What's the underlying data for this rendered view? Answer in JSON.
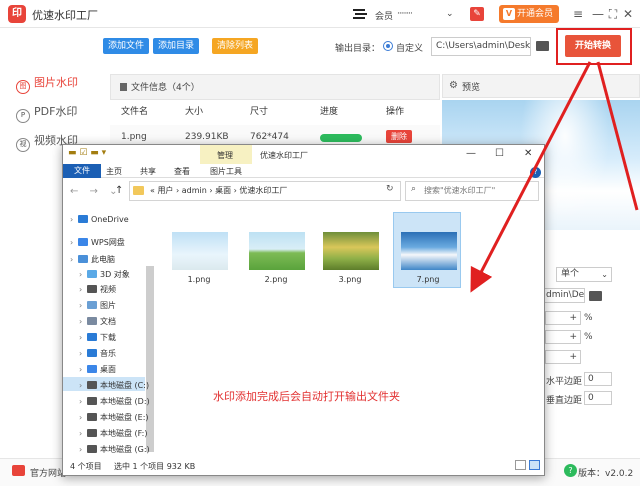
{
  "app": {
    "title": "优速水印工厂",
    "logo_text": "印",
    "member_label": "会员",
    "member_mask": "········",
    "vip_button": "开通会员",
    "vip_icon_text": "V",
    "win_minimize": "—",
    "win_maximize": "⛶",
    "win_close": "✕",
    "win_menu": "≡"
  },
  "sidebar": {
    "items": [
      {
        "label": "图片水印",
        "icon": "图"
      },
      {
        "label": "PDF水印",
        "icon": "P"
      },
      {
        "label": "视频水印",
        "icon": "视"
      }
    ]
  },
  "toolbar": {
    "add_file": "添加文件",
    "add_dir": "添加目录",
    "clear_list": "清除列表",
    "output_label": "输出目录：",
    "custom_label": "自定义",
    "output_path": "C:\\Users\\admin\\Deskto",
    "start_button": "开始转换"
  },
  "file_info": {
    "title": "文件信息（4个）",
    "columns": [
      "文件名",
      "大小",
      "尺寸",
      "进度",
      "操作"
    ],
    "row": {
      "name": "1.png",
      "size": "239.91KB",
      "dims": "762*474",
      "delete": "删除"
    }
  },
  "preview": {
    "title": "预览"
  },
  "options": {
    "select_value": "单个",
    "path_value": "dmin\\Des",
    "pct": "%",
    "h_margin": "水平边距",
    "v_margin": "垂直边距",
    "h_value": "0",
    "v_value": "0"
  },
  "footer": {
    "site": "官方网站",
    "help": "?",
    "version": "版本：v2.0.2"
  },
  "explorer": {
    "name": "优速水印工厂",
    "manage_tab": "管理",
    "picture_tools": "图片工具",
    "tabs": [
      "文件",
      "主页",
      "共享",
      "查看"
    ],
    "address": "«  用户  ›  admin  ›  桌面  ›  优速水印工厂",
    "search_placeholder": "搜索\"优速水印工厂\"",
    "nav": [
      {
        "label": "OneDrive",
        "color": "#2a7bd6",
        "indent": 0
      },
      {
        "label": "WPS网盘",
        "color": "#3b86e8",
        "indent": 0
      },
      {
        "label": "此电脑",
        "color": "#4a90d9",
        "indent": 0
      },
      {
        "label": "3D 对象",
        "color": "#5aa9e6",
        "indent": 1
      },
      {
        "label": "视频",
        "color": "#555555",
        "indent": 1
      },
      {
        "label": "图片",
        "color": "#6a9fd4",
        "indent": 1
      },
      {
        "label": "文档",
        "color": "#7a8aa0",
        "indent": 1
      },
      {
        "label": "下载",
        "color": "#2a7bd6",
        "indent": 1
      },
      {
        "label": "音乐",
        "color": "#2a7bd6",
        "indent": 1
      },
      {
        "label": "桌面",
        "color": "#3b86e8",
        "indent": 1
      },
      {
        "label": "本地磁盘 (C:)",
        "color": "#555555",
        "indent": 1
      },
      {
        "label": "本地磁盘 (D:)",
        "color": "#555555",
        "indent": 1
      },
      {
        "label": "本地磁盘 (E:)",
        "color": "#555555",
        "indent": 1
      },
      {
        "label": "本地磁盘 (F:)",
        "color": "#555555",
        "indent": 1
      },
      {
        "label": "本地磁盘 (G:)",
        "color": "#555555",
        "indent": 1
      }
    ],
    "files": [
      {
        "name": "1.png"
      },
      {
        "name": "2.png"
      },
      {
        "name": "3.png"
      },
      {
        "name": "7.png"
      }
    ],
    "caption": "水印添加完成后会自动打开输出文件夹",
    "status_count": "4 个项目",
    "status_selected": "选中 1 个项目  932 KB"
  },
  "colors": {
    "accent_red": "#e8443a",
    "blue_button": "#2f8be6",
    "orange_button": "#f5a623",
    "arrow_red": "#e02020"
  }
}
